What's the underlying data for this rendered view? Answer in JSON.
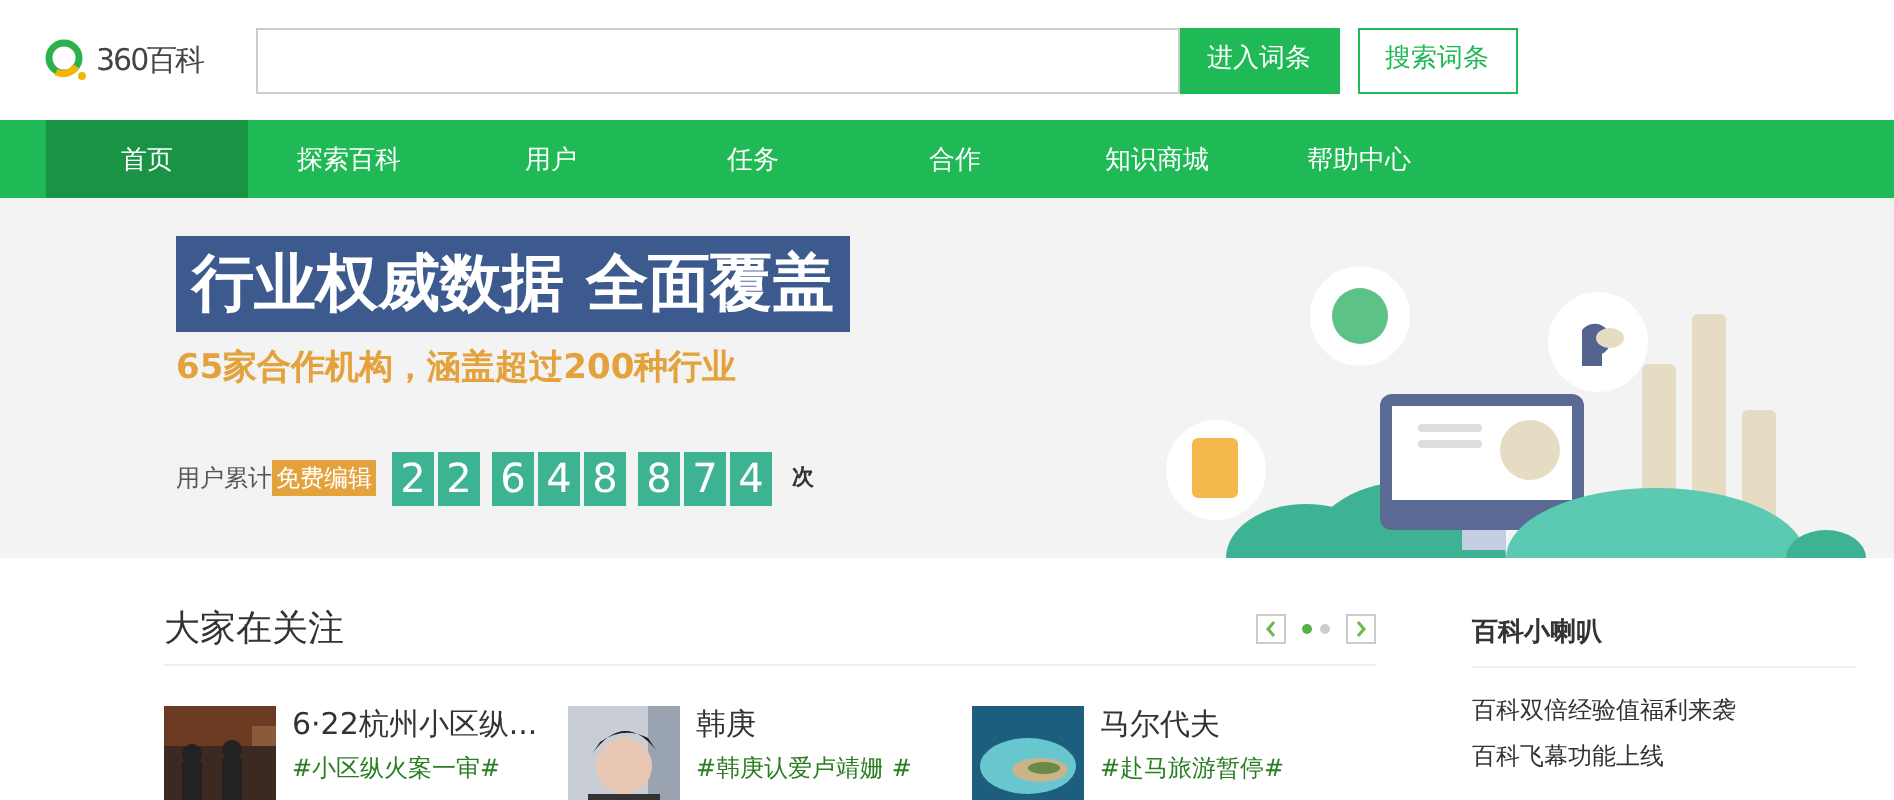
{
  "logo": {
    "text": "360百科"
  },
  "search": {
    "buttons": [
      {
        "label": "进入词条",
        "kind": "primary"
      },
      {
        "label": "搜索词条",
        "kind": "outline"
      }
    ]
  },
  "nav": [
    {
      "label": "首页",
      "selected": true
    },
    {
      "label": "探索百科",
      "selected": false
    },
    {
      "label": "用户",
      "selected": false
    },
    {
      "label": "任务",
      "selected": false
    },
    {
      "label": "合作",
      "selected": false
    },
    {
      "label": "知识商城",
      "selected": false
    },
    {
      "label": "帮助中心",
      "selected": false
    }
  ],
  "banner": {
    "headline": "行业权威数据 全面覆盖",
    "subline": "65家合作机构，涵盖超过200种行业",
    "counter_label": "用户累计",
    "counter_tag": "免费编辑",
    "counter_groups": [
      [
        "2",
        "2"
      ],
      [
        "6",
        "4",
        "8"
      ],
      [
        "8",
        "7",
        "4"
      ]
    ],
    "counter_unit": "次"
  },
  "featured": {
    "title": "大家在关注",
    "pager": [
      {
        "selected": true
      },
      {
        "selected": false
      }
    ],
    "cards": [
      {
        "title": "6·22杭州小区纵...",
        "tag": "#小区纵火案一审#",
        "kind": "picture"
      },
      {
        "title": "韩庚",
        "tag": "#韩庚认爱卢靖姗 #",
        "kind": "picture"
      },
      {
        "title": "马尔代夫",
        "tag": "#赴马旅游暂停#",
        "kind": "picture"
      }
    ]
  },
  "sidebar": {
    "title": "百科小喇叭",
    "items": [
      "百科双倍经验值福利来袭",
      "百科飞幕功能上线"
    ]
  }
}
